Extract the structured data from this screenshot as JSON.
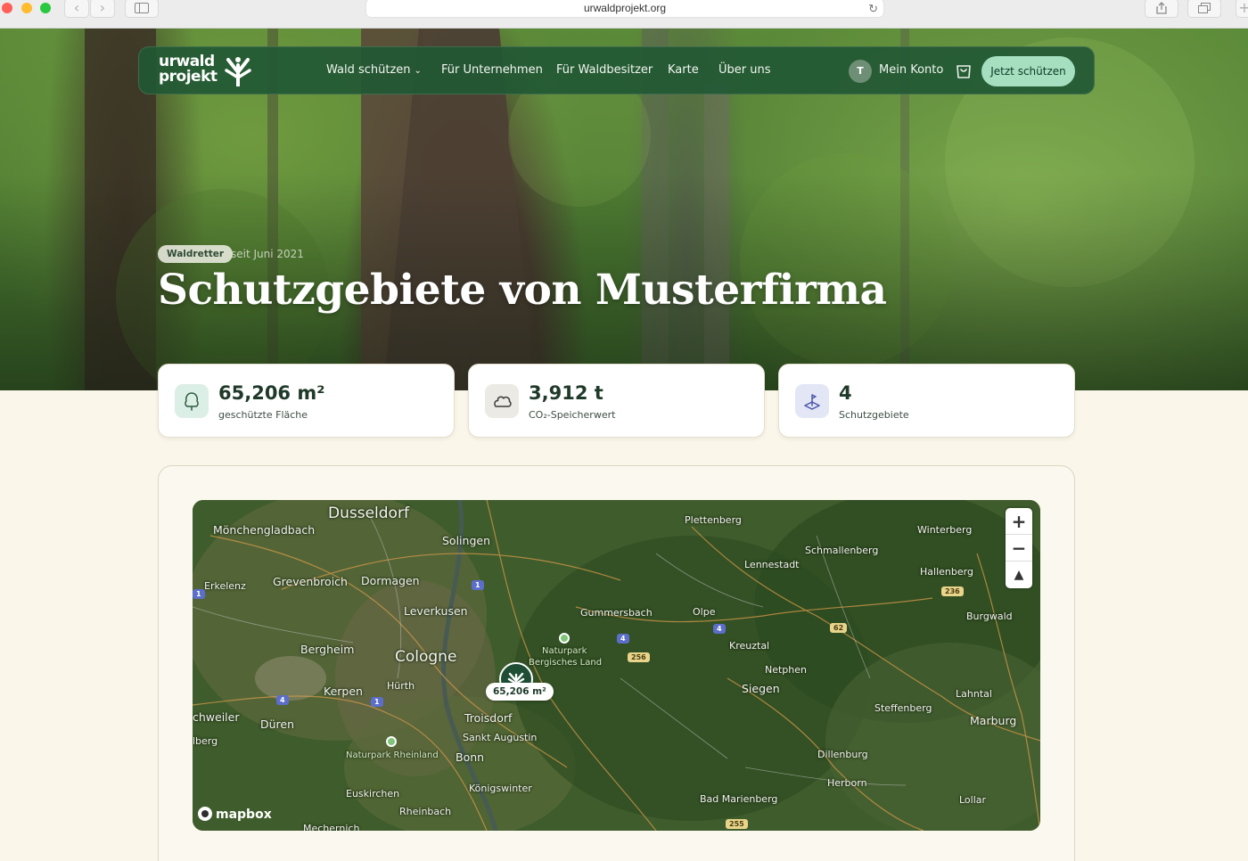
{
  "browser": {
    "url": "urwaldprojekt.org",
    "back_icon": "chevron-left-icon",
    "forward_icon": "chevron-right-icon"
  },
  "nav": {
    "logo_line1": "urwald",
    "logo_line2": "projekt",
    "links": [
      "Wald schützen",
      "Für Unternehmen",
      "Für Waldbesitzer",
      "Karte",
      "Über uns"
    ],
    "account_initial": "T",
    "account_label": "Mein Konto",
    "cta_label": "Jetzt schützen"
  },
  "hero": {
    "badge": "Waldretter",
    "since": "seit Juni 2021",
    "title": "Schutzgebiete von Musterfirma"
  },
  "stats": [
    {
      "value": "65,206 m²",
      "label": "geschützte Fläche",
      "icon": "tree-icon",
      "icon_bg": "#dcefe6"
    },
    {
      "value": "3,912 t",
      "label": "CO₂-Speicherwert",
      "icon": "cloud-icon",
      "icon_bg": "#eceae4"
    },
    {
      "value": "4",
      "label": "Schutzgebiete",
      "icon": "area-pin-icon",
      "icon_bg": "#e3e6f5"
    }
  ],
  "map": {
    "cities": [
      {
        "name": "Dusseldorf",
        "size": "lg"
      },
      {
        "name": "Mönchengladbach",
        "size": "md"
      },
      {
        "name": "Solingen",
        "size": "md"
      },
      {
        "name": "Erkelenz",
        "size": "sm"
      },
      {
        "name": "Grevenbroich",
        "size": "md"
      },
      {
        "name": "Dormagen",
        "size": "md"
      },
      {
        "name": "Leverkusen",
        "size": "md"
      },
      {
        "name": "Bergheim",
        "size": "md"
      },
      {
        "name": "Cologne",
        "size": "lg"
      },
      {
        "name": "Hürth",
        "size": "sm"
      },
      {
        "name": "Kerpen",
        "size": "md"
      },
      {
        "name": "chweiler",
        "size": "md"
      },
      {
        "name": "Düren",
        "size": "md"
      },
      {
        "name": "lberg",
        "size": "sm"
      },
      {
        "name": "Troisdorf",
        "size": "md"
      },
      {
        "name": "Sankt Augustin",
        "size": "sm"
      },
      {
        "name": "Bonn",
        "size": "md"
      },
      {
        "name": "Königswinter",
        "size": "sm"
      },
      {
        "name": "Euskirchen",
        "size": "sm"
      },
      {
        "name": "Rheinbach",
        "size": "sm"
      },
      {
        "name": "Mechernich",
        "size": "sm"
      },
      {
        "name": "Gummersbach",
        "size": "sm"
      },
      {
        "name": "Olpe",
        "size": "sm"
      },
      {
        "name": "Plettenberg",
        "size": "sm"
      },
      {
        "name": "Lennestadt",
        "size": "sm"
      },
      {
        "name": "Schmallenberg",
        "size": "sm"
      },
      {
        "name": "Winterberg",
        "size": "sm"
      },
      {
        "name": "Hallenberg",
        "size": "sm"
      },
      {
        "name": "Burgwald",
        "size": "sm"
      },
      {
        "name": "Kreuztal",
        "size": "sm"
      },
      {
        "name": "Netphen",
        "size": "sm"
      },
      {
        "name": "Siegen",
        "size": "md"
      },
      {
        "name": "Lahntal",
        "size": "sm"
      },
      {
        "name": "Steffenberg",
        "size": "sm"
      },
      {
        "name": "Marburg",
        "size": "md"
      },
      {
        "name": "Dillenburg",
        "size": "sm"
      },
      {
        "name": "Herborn",
        "size": "sm"
      },
      {
        "name": "Bad Marienberg",
        "size": "sm"
      },
      {
        "name": "Lollar",
        "size": "sm"
      }
    ],
    "parks": [
      "Naturpark",
      "Bergisches Land",
      "Naturpark Rheinland"
    ],
    "road_badges": [
      "1",
      "1",
      "4",
      "1",
      "4",
      "4",
      "256",
      "62",
      "236",
      "255"
    ],
    "marker_label": "65,206 m²",
    "attribution": "mapbox",
    "zoom_in": "+",
    "zoom_out": "−",
    "compass": "▲"
  }
}
